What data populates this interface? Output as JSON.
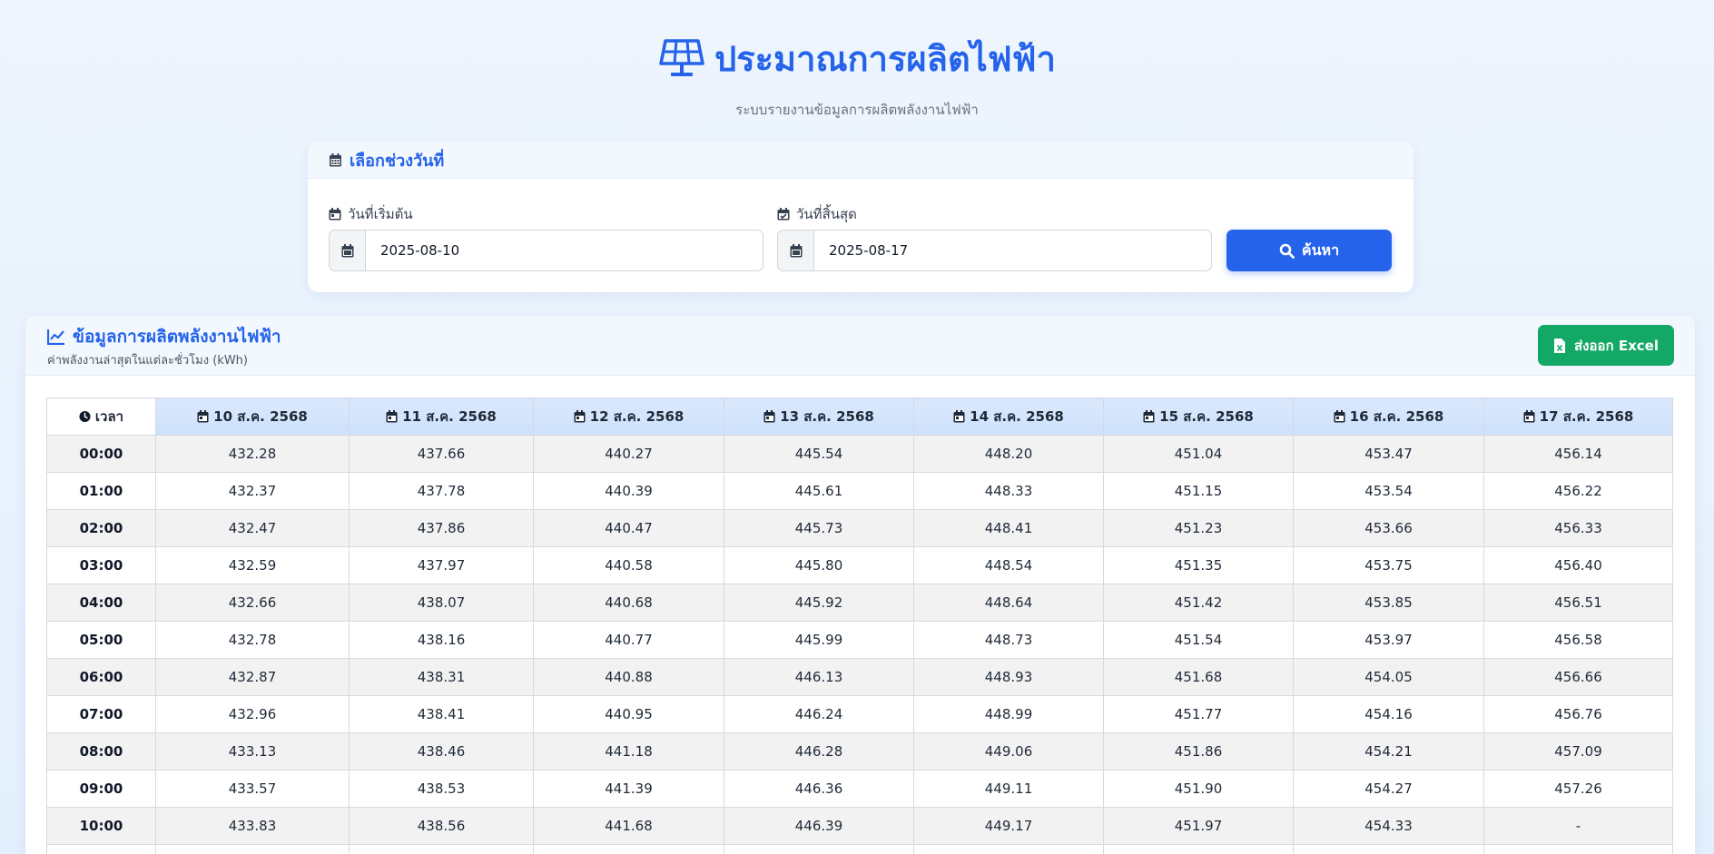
{
  "header": {
    "title": "ประมาณการผลิตไฟฟ้า",
    "subtitle": "ระบบรายงานข้อมูลการผลิตพลังงานไฟฟ้า"
  },
  "date_picker": {
    "title": "เลือกช่วงวันที่",
    "start_label": "วันที่เริ่มต้น",
    "start_value": "2025-08-10",
    "end_label": "วันที่สิ้นสุด",
    "end_value": "2025-08-17",
    "search_label": "ค้นหา"
  },
  "data_section": {
    "title": "ข้อมูลการผลิตพลังงานไฟฟ้า",
    "subtitle": "ค่าพลังงานล่าสุดในแต่ละชั่วโมง (kWh)",
    "export_label": "ส่งออก Excel"
  },
  "table": {
    "time_header": "เวลา",
    "dates": [
      "10 ส.ค. 2568",
      "11 ส.ค. 2568",
      "12 ส.ค. 2568",
      "13 ส.ค. 2568",
      "14 ส.ค. 2568",
      "15 ส.ค. 2568",
      "16 ส.ค. 2568",
      "17 ส.ค. 2568"
    ],
    "rows": [
      {
        "time": "00:00",
        "values": [
          "432.28",
          "437.66",
          "440.27",
          "445.54",
          "448.20",
          "451.04",
          "453.47",
          "456.14"
        ]
      },
      {
        "time": "01:00",
        "values": [
          "432.37",
          "437.78",
          "440.39",
          "445.61",
          "448.33",
          "451.15",
          "453.54",
          "456.22"
        ]
      },
      {
        "time": "02:00",
        "values": [
          "432.47",
          "437.86",
          "440.47",
          "445.73",
          "448.41",
          "451.23",
          "453.66",
          "456.33"
        ]
      },
      {
        "time": "03:00",
        "values": [
          "432.59",
          "437.97",
          "440.58",
          "445.80",
          "448.54",
          "451.35",
          "453.75",
          "456.40"
        ]
      },
      {
        "time": "04:00",
        "values": [
          "432.66",
          "438.07",
          "440.68",
          "445.92",
          "448.64",
          "451.42",
          "453.85",
          "456.51"
        ]
      },
      {
        "time": "05:00",
        "values": [
          "432.78",
          "438.16",
          "440.77",
          "445.99",
          "448.73",
          "451.54",
          "453.97",
          "456.58"
        ]
      },
      {
        "time": "06:00",
        "values": [
          "432.87",
          "438.31",
          "440.88",
          "446.13",
          "448.93",
          "451.68",
          "454.05",
          "456.66"
        ]
      },
      {
        "time": "07:00",
        "values": [
          "432.96",
          "438.41",
          "440.95",
          "446.24",
          "448.99",
          "451.77",
          "454.16",
          "456.76"
        ]
      },
      {
        "time": "08:00",
        "values": [
          "433.13",
          "438.46",
          "441.18",
          "446.28",
          "449.06",
          "451.86",
          "454.21",
          "457.09"
        ]
      },
      {
        "time": "09:00",
        "values": [
          "433.57",
          "438.53",
          "441.39",
          "446.36",
          "449.11",
          "451.90",
          "454.27",
          "457.26"
        ]
      },
      {
        "time": "10:00",
        "values": [
          "433.83",
          "438.56",
          "441.68",
          "446.39",
          "449.17",
          "451.97",
          "454.33",
          "-"
        ]
      },
      {
        "time": "",
        "values": [
          "",
          "",
          "",
          "",
          "",
          "",
          "",
          ""
        ]
      }
    ]
  },
  "icons": {
    "title": "solar-panel-icon",
    "date_picker": "calendar-icon",
    "start_date": "calendar-day-icon",
    "end_date": "calendar-check-icon",
    "search": "search-icon",
    "data_section": "line-chart-icon",
    "export": "excel-file-icon",
    "time": "clock-icon",
    "date_column": "calendar-day-icon"
  },
  "colors": {
    "primary": "#2563eb",
    "success": "#14a866",
    "header_row": "#dbe9fd",
    "stripe": "#f2f2f3"
  }
}
